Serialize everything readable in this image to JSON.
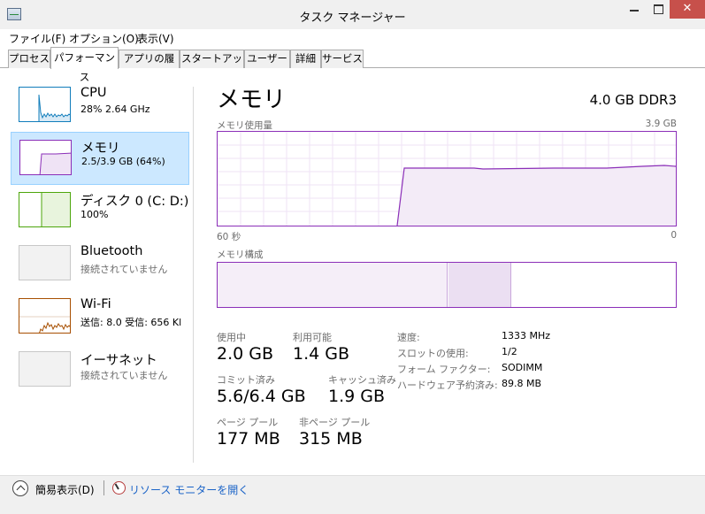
{
  "window": {
    "title": "タスク マネージャー",
    "close_glyph": "✕"
  },
  "menu": [
    "ファイル(F)",
    "オプション(O)",
    "表示(V)"
  ],
  "tabs": [
    "プロセス",
    "パフォーマンス",
    "アプリの履歴",
    "スタートアップ",
    "ユーザー",
    "詳細",
    "サービス"
  ],
  "sidebar": {
    "items": [
      {
        "title": "CPU",
        "sub": "28%  2.64 GHz"
      },
      {
        "title": "メモリ",
        "sub": "2.5/3.9 GB (64%)"
      },
      {
        "title": "ディスク 0 (C: D:)",
        "sub": "100%"
      },
      {
        "title": "Bluetooth",
        "sub": "接続されていません"
      },
      {
        "title": "Wi-Fi",
        "sub": "送信: 8.0  受信: 656 Kl"
      },
      {
        "title": "イーサネット",
        "sub": "接続されていません"
      }
    ]
  },
  "memory": {
    "title": "メモリ",
    "spec": "4.0 GB DDR3",
    "usage_label": "メモリ使用量",
    "usage_max": "3.9 GB",
    "time_left": "60 秒",
    "time_right": "0",
    "composition_label": "メモリ構成",
    "stats": {
      "in_use_label": "使用中",
      "in_use": "2.0 GB",
      "available_label": "利用可能",
      "available": "1.4 GB",
      "committed_label": "コミット済み",
      "committed": "5.6/6.4 GB",
      "cached_label": "キャッシュ済み",
      "cached": "1.9 GB",
      "paged_pool_label": "ページ プール",
      "paged_pool": "177 MB",
      "nonpaged_pool_label": "非ページ プール",
      "nonpaged_pool": "315 MB"
    },
    "details": [
      {
        "key": "速度:",
        "value": "1333 MHz"
      },
      {
        "key": "スロットの使用:",
        "value": "1/2"
      },
      {
        "key": "フォーム ファクター:",
        "value": "SODIMM"
      },
      {
        "key": "ハードウェア予約済み:",
        "value": "89.8 MB"
      }
    ]
  },
  "footer": {
    "collapse_label": "簡易表示(D)",
    "monitor_link": "リソース モニターを開く"
  },
  "colors": {
    "memory_accent": "#8b2fb8",
    "cpu_accent": "#117dbb",
    "disk_accent": "#4da60c",
    "wifi_accent": "#a74f01",
    "selected_bg": "#cce8ff",
    "close_bg": "#c7504b"
  }
}
